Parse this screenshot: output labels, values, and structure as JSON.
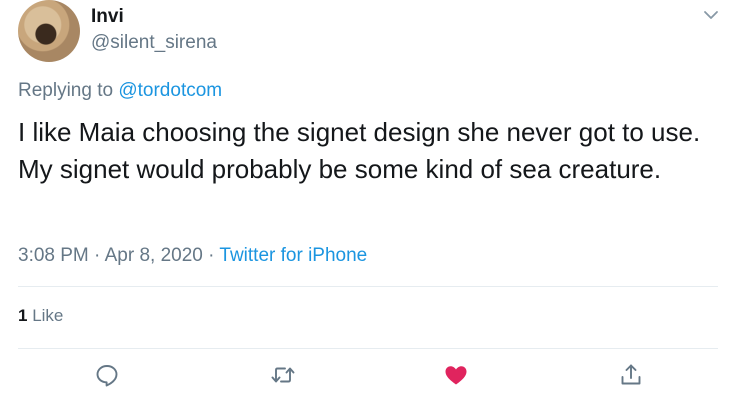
{
  "tweet": {
    "display_name": "Invi",
    "handle": "@silent_sirena",
    "replying_prefix": "Replying to ",
    "replying_to": "@tordotcom",
    "text": "I like Maia choosing the signet design she never got to use. My signet would probably be some kind of sea creature.",
    "time": "3:08 PM",
    "sep1": " · ",
    "date": "Apr 8, 2020",
    "sep2": " · ",
    "source": "Twitter for iPhone",
    "like_count": "1",
    "like_label": " Like"
  },
  "icons": {
    "menu": "chevron-down-icon",
    "reply": "speech-bubble-icon",
    "retweet": "retweet-icon",
    "like": "heart-icon",
    "share": "share-icon"
  },
  "colors": {
    "link": "#1b95e0",
    "secondary_text": "#657786",
    "like_active": "#e0245e"
  }
}
